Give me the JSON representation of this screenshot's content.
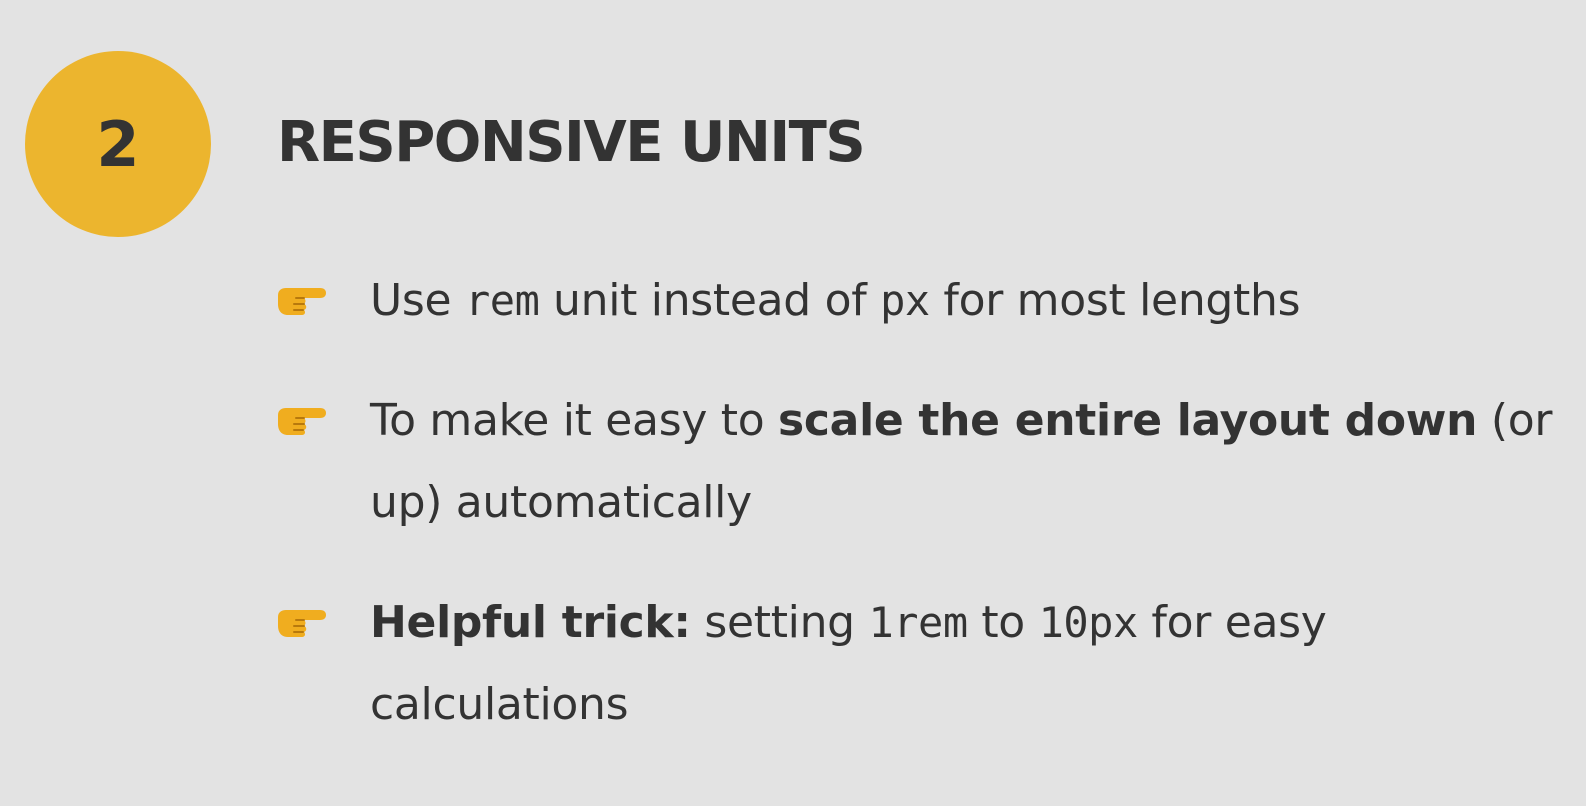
{
  "badge": {
    "number": "2",
    "color": "#ecb52e"
  },
  "title": "RESPONSIVE UNITS",
  "bullets": [
    {
      "icon": "pointing-right-hand-icon",
      "t1": "Use ",
      "code1": "rem",
      "t2": " unit instead of ",
      "code2": "px",
      "t3": " for most lengths"
    },
    {
      "icon": "pointing-right-hand-icon",
      "t1": "To make it easy to ",
      "strong": "scale the entire layout down",
      "t2": " (or up) automatically"
    },
    {
      "icon": "pointing-right-hand-icon",
      "strong": "Helpful trick:",
      "t1": " setting ",
      "code1": "1rem",
      "t2": " to ",
      "code2": "10px",
      "t3": " for easy calculations"
    }
  ],
  "colors": {
    "background": "#e3e3e3",
    "text": "#333333",
    "accent": "#ecb52e",
    "icon": "#f0ad1f"
  }
}
